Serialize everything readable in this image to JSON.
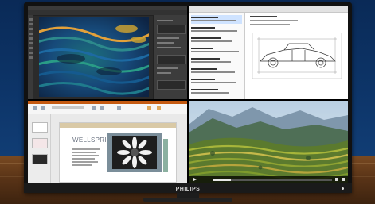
{
  "monitor": {
    "brand": "PHILIPS",
    "quadrants": [
      "photo-editor",
      "mail-with-cad-drawing",
      "presentation",
      "video-player"
    ]
  },
  "presentation": {
    "slide_title": "WELLSPRING"
  },
  "video": {
    "progress": 0.15
  },
  "colors": {
    "wall": "#0d3569",
    "desk": "#5a3417",
    "bezel": "#111111"
  }
}
